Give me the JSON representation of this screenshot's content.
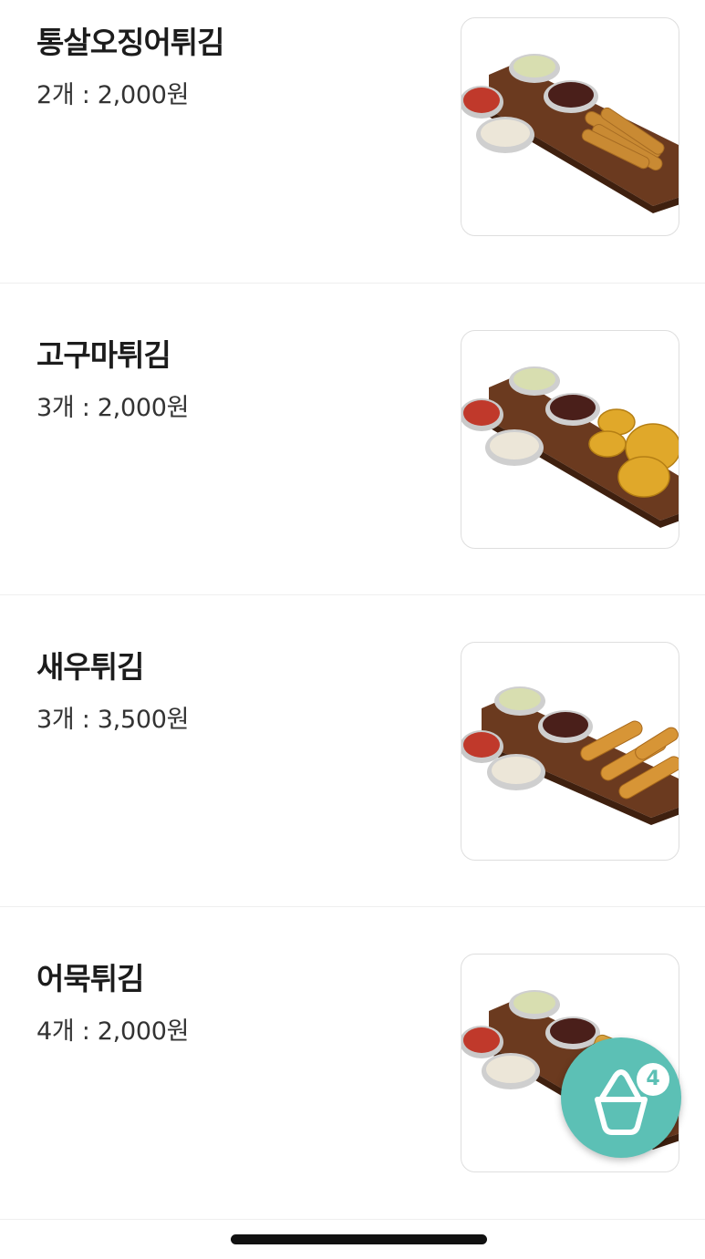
{
  "menu": {
    "items": [
      {
        "name": "통살오징어튀김",
        "price": "2개 : 2,000원",
        "image_icon": "fried-squid-platter-icon"
      },
      {
        "name": "고구마튀김",
        "price": "3개 : 2,000원",
        "image_icon": "fried-sweet-potato-platter-icon"
      },
      {
        "name": "새우튀김",
        "price": "3개 : 3,500원",
        "image_icon": "fried-shrimp-platter-icon"
      },
      {
        "name": "어묵튀김",
        "price": "4개 : 2,000원",
        "image_icon": "fried-fishcake-platter-icon"
      }
    ]
  },
  "cart": {
    "icon": "basket-icon",
    "count": "4",
    "color": "#5cc0b5"
  }
}
